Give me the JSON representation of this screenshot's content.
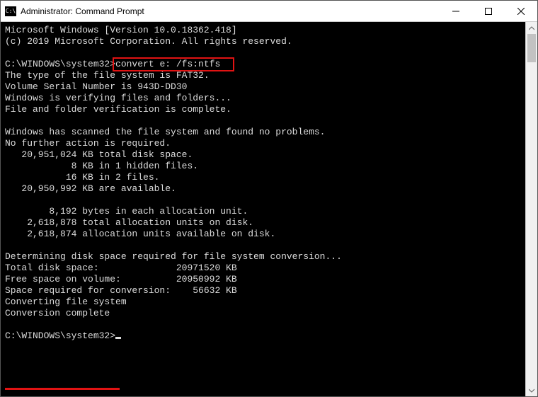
{
  "window": {
    "title": "Administrator: Command Prompt"
  },
  "terminal": {
    "prompt1": "C:\\WINDOWS\\system32>",
    "command": "convert e: /fs:ntfs",
    "prompt2": "C:\\WINDOWS\\system32>",
    "lines": [
      "Microsoft Windows [Version 10.0.18362.418]",
      "(c) 2019 Microsoft Corporation. All rights reserved.",
      "",
      "__PROMPT_CMD__",
      "The type of the file system is FAT32.",
      "Volume Serial Number is 943D-DD30",
      "Windows is verifying files and folders...",
      "File and folder verification is complete.",
      "",
      "Windows has scanned the file system and found no problems.",
      "No further action is required.",
      "   20,951,024 KB total disk space.",
      "            8 KB in 1 hidden files.",
      "           16 KB in 2 files.",
      "   20,950,992 KB are available.",
      "",
      "        8,192 bytes in each allocation unit.",
      "    2,618,878 total allocation units on disk.",
      "    2,618,874 allocation units available on disk.",
      "",
      "Determining disk space required for file system conversion...",
      "Total disk space:              20971520 KB",
      "Free space on volume:          20950992 KB",
      "Space required for conversion:    56632 KB",
      "Converting file system",
      "Conversion complete",
      "",
      "__PROMPT_ONLY__"
    ]
  },
  "annotations": {
    "highlighted_command": "convert e: /fs:ntfs",
    "underlined_text": "Conversion complete"
  },
  "colors": {
    "terminal_bg": "#000000",
    "terminal_fg": "#dcdcdc",
    "highlight": "#e11313"
  }
}
